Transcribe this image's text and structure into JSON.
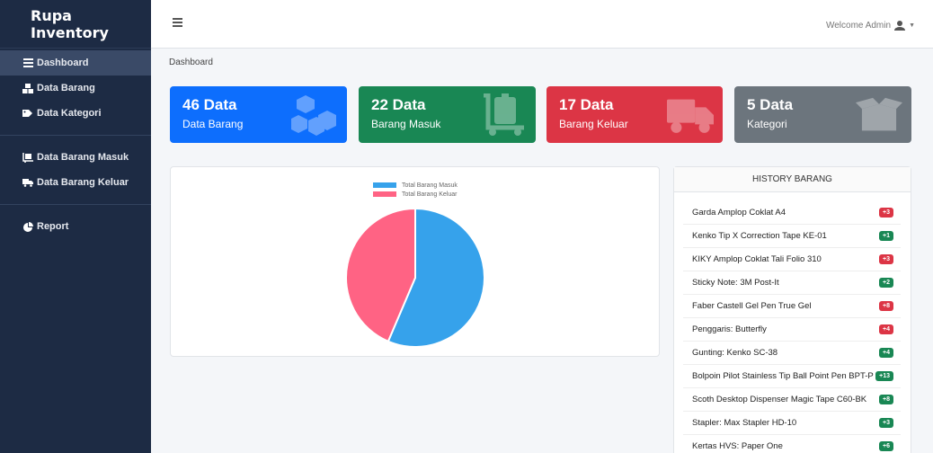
{
  "brand": "Rupa Inventory",
  "sidebar": {
    "items": [
      {
        "label": "Dashboard",
        "icon": "dashboard-icon",
        "active": true
      },
      {
        "label": "Data Barang",
        "icon": "boxes-icon"
      },
      {
        "label": "Data Kategori",
        "icon": "tags-icon"
      },
      {
        "label": "Data Barang Masuk",
        "icon": "dolly-icon"
      },
      {
        "label": "Data Barang Keluar",
        "icon": "truck-icon"
      },
      {
        "label": "Report",
        "icon": "pie-chart-icon"
      }
    ]
  },
  "topbar": {
    "welcome": "Welcome Admin"
  },
  "breadcrumb": "Dashboard",
  "cards": [
    {
      "value": "46 Data",
      "label": "Data Barang",
      "icon": "cubes-icon",
      "color": "#0d6efd"
    },
    {
      "value": "22 Data",
      "label": "Barang Masuk",
      "icon": "dolly-icon",
      "color": "#198754"
    },
    {
      "value": "17 Data",
      "label": "Barang Keluar",
      "icon": "truck-icon",
      "color": "#dc3545"
    },
    {
      "value": "5 Data",
      "label": "Kategori",
      "icon": "open-box-icon",
      "color": "#6c757d"
    }
  ],
  "chart_data": {
    "type": "pie",
    "categories": [
      "Total Barang Masuk",
      "Total Barang Keluar"
    ],
    "values": [
      22,
      17
    ],
    "colors": [
      "#36a2eb",
      "#ff6384"
    ],
    "legend_position": "top"
  },
  "history": {
    "title": "HISTORY BARANG",
    "items": [
      {
        "name": "Garda Amplop Coklat A4",
        "badge": "+3",
        "color": "red"
      },
      {
        "name": "Kenko Tip X Correction Tape KE-01",
        "badge": "+1",
        "color": "green"
      },
      {
        "name": "KIKY Amplop Coklat Tali Folio 310",
        "badge": "+3",
        "color": "red"
      },
      {
        "name": "Sticky Note: 3M Post-It",
        "badge": "+2",
        "color": "green"
      },
      {
        "name": "Faber Castell Gel Pen True Gel",
        "badge": "+8",
        "color": "red"
      },
      {
        "name": "Penggaris: Butterfly",
        "badge": "+4",
        "color": "red"
      },
      {
        "name": "Gunting: Kenko SC-38",
        "badge": "+4",
        "color": "green"
      },
      {
        "name": "Bolpoin Pilot Stainless Tip Ball Point Pen BPT-P",
        "badge": "+13",
        "color": "green"
      },
      {
        "name": "Scoth Desktop Dispenser Magic Tape C60-BK",
        "badge": "+8",
        "color": "green"
      },
      {
        "name": "Stapler: Max Stapler HD-10",
        "badge": "+3",
        "color": "green"
      },
      {
        "name": "Kertas HVS: Paper One",
        "badge": "+6",
        "color": "green"
      }
    ]
  }
}
